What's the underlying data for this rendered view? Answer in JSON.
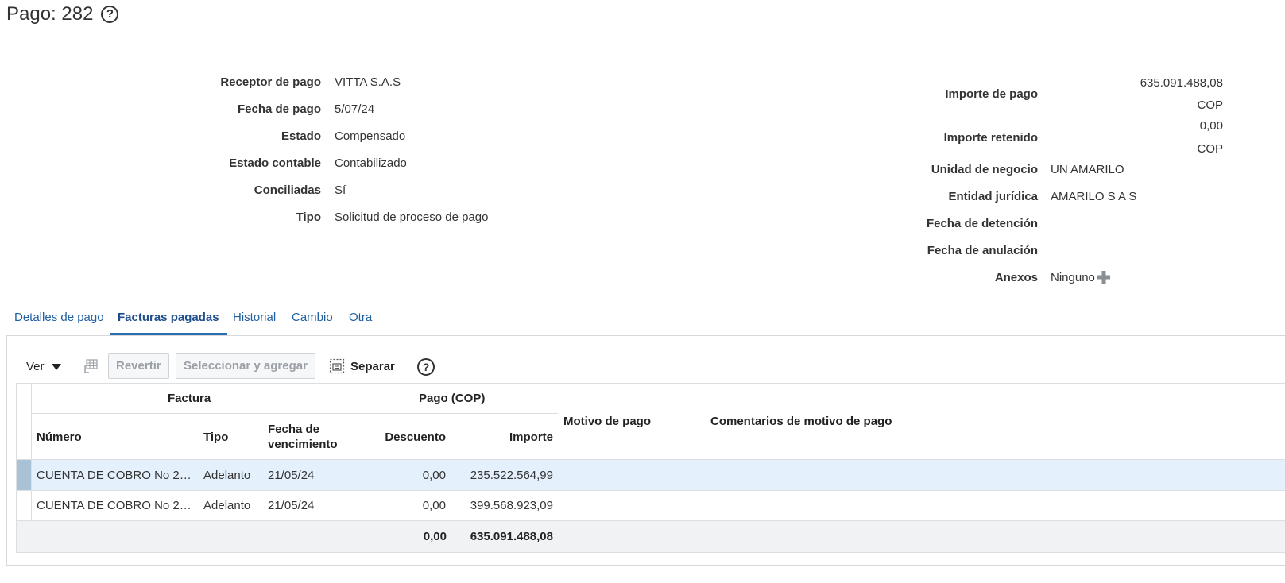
{
  "page": {
    "title": "Pago: 282",
    "help_icon": "question-circle-icon"
  },
  "summary_left": [
    {
      "label": "Receptor de pago",
      "value": "VITTA S.A.S"
    },
    {
      "label": "Fecha de pago",
      "value": "5/07/24"
    },
    {
      "label": "Estado",
      "value": "Compensado"
    },
    {
      "label": "Estado contable",
      "value": "Contabilizado"
    },
    {
      "label": "Conciliadas",
      "value": "Sí"
    },
    {
      "label": "Tipo",
      "value": "Solicitud de proceso de pago"
    }
  ],
  "summary_right": {
    "importe_pago": {
      "label": "Importe de pago",
      "amount": "635.091.488,08",
      "currency": "COP"
    },
    "importe_retenido": {
      "label": "Importe retenido",
      "amount": "0,00",
      "currency": "COP"
    },
    "unidad_negocio": {
      "label": "Unidad de negocio",
      "value": "UN AMARILO"
    },
    "entidad_juridica": {
      "label": "Entidad jurídica",
      "value": "AMARILO S A S"
    },
    "fecha_detencion": {
      "label": "Fecha de detención",
      "value": ""
    },
    "fecha_anulacion": {
      "label": "Fecha de anulación",
      "value": ""
    },
    "anexos": {
      "label": "Anexos",
      "value": "Ninguno",
      "add_icon": "plus-icon"
    }
  },
  "tabs": [
    {
      "label": "Detalles de pago",
      "active": false
    },
    {
      "label": "Facturas pagadas",
      "active": true
    },
    {
      "label": "Historial",
      "active": false
    },
    {
      "label": "Cambio",
      "active": false
    },
    {
      "label": "Otra",
      "active": false
    }
  ],
  "toolbar": {
    "ver_label": "Ver",
    "freeze_icon": "freeze-columns-icon",
    "revertir_label": "Revertir",
    "seleccionar_label": "Seleccionar y agregar",
    "separar_label": "Separar",
    "separar_icon": "detach-icon",
    "help_icon": "question-circle-icon"
  },
  "table": {
    "group_headers": {
      "factura": "Factura",
      "pago": "Pago (COP)"
    },
    "columns": {
      "numero": "Número",
      "tipo": "Tipo",
      "fecha_venc_1": "Fecha de",
      "fecha_venc_2": "vencimiento",
      "descuento": "Descuento",
      "importe": "Importe",
      "motivo": "Motivo de pago",
      "comentarios": "Comentarios de motivo de pago"
    },
    "rows": [
      {
        "numero": "CUENTA DE COBRO No 2…",
        "tipo": "Adelanto",
        "fecha": "21/05/24",
        "descuento": "0,00",
        "importe": "235.522.564,99",
        "motivo": "",
        "comentarios": ""
      },
      {
        "numero": "CUENTA DE COBRO No 2…",
        "tipo": "Adelanto",
        "fecha": "21/05/24",
        "descuento": "0,00",
        "importe": "399.568.923,09",
        "motivo": "",
        "comentarios": ""
      }
    ],
    "totals": {
      "descuento": "0,00",
      "importe": "635.091.488,08"
    }
  },
  "colors": {
    "link": "#1f5fa0",
    "selected_row": "#e4f0fb",
    "row_indicator": "#a9c2d6"
  }
}
